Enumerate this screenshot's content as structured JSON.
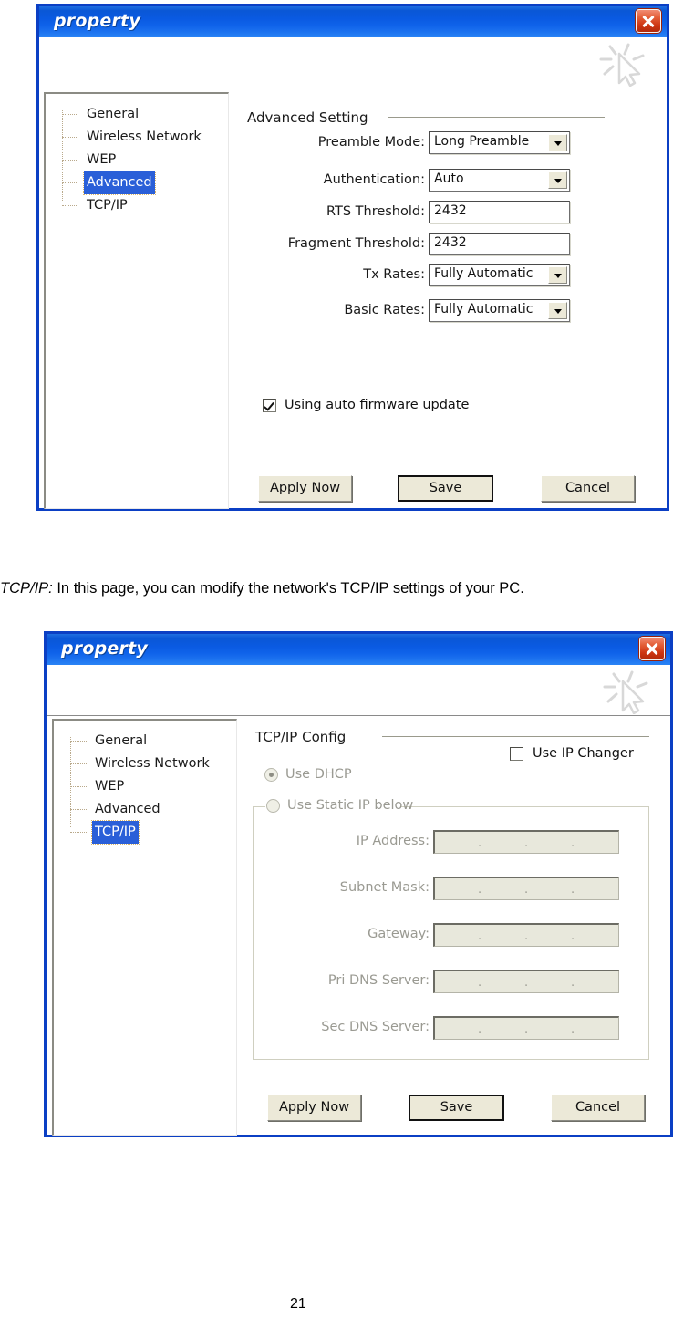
{
  "page": {
    "number": "21",
    "paragraph_emphasis": "TCP/IP:",
    "paragraph_text": " In this page, you can modify the network's TCP/IP settings of your PC."
  },
  "colors": {
    "titlebar_blue": "#0a57d6",
    "frame_blue": "#0b3fc4",
    "selection_blue": "#2a5fd8",
    "close_red": "#cd3512",
    "button_face": "#ece9d8",
    "disabled_field": "#e8e8dc",
    "disabled_text": "#9a9a92"
  },
  "dialog_advanced": {
    "title": "property",
    "close_label": "Close",
    "tree": {
      "items": [
        {
          "label": "General",
          "selected": false
        },
        {
          "label": "Wireless Network",
          "selected": false
        },
        {
          "label": "WEP",
          "selected": false
        },
        {
          "label": "Advanced",
          "selected": true
        },
        {
          "label": "TCP/IP",
          "selected": false
        }
      ]
    },
    "group_title": "Advanced Setting",
    "fields": [
      {
        "label": "Preamble Mode:",
        "value": "Long Preamble",
        "type": "combo"
      },
      {
        "label": "Authentication:",
        "value": "Auto",
        "type": "combo"
      },
      {
        "label": "RTS Threshold:",
        "value": "2432",
        "type": "text"
      },
      {
        "label": "Fragment Threshold:",
        "value": "2432",
        "type": "text"
      },
      {
        "label": "Tx Rates:",
        "value": "Fully Automatic",
        "type": "combo"
      },
      {
        "label": "Basic Rates:",
        "value": "Fully Automatic",
        "type": "combo"
      }
    ],
    "checkbox": {
      "label": "Using auto firmware update",
      "checked": true
    },
    "buttons": {
      "apply": "Apply Now",
      "save": "Save",
      "cancel": "Cancel"
    }
  },
  "dialog_tcpip": {
    "title": "property",
    "close_label": "Close",
    "tree": {
      "items": [
        {
          "label": "General",
          "selected": false
        },
        {
          "label": "Wireless Network",
          "selected": false
        },
        {
          "label": "WEP",
          "selected": false
        },
        {
          "label": "Advanced",
          "selected": false
        },
        {
          "label": "TCP/IP",
          "selected": true
        }
      ]
    },
    "group_title": "TCP/IP Config",
    "ip_changer": {
      "label": "Use IP Changer",
      "checked": false
    },
    "radios": [
      {
        "label": "Use DHCP",
        "selected": true
      },
      {
        "label": "Use Static IP below",
        "selected": false
      }
    ],
    "fields": [
      {
        "label": "IP Address:",
        "value": ""
      },
      {
        "label": "Subnet Mask:",
        "value": ""
      },
      {
        "label": "Gateway:",
        "value": ""
      },
      {
        "label": "Pri DNS Server:",
        "value": ""
      },
      {
        "label": "Sec DNS Server:",
        "value": ""
      }
    ],
    "ip_separator": ".",
    "buttons": {
      "apply": "Apply Now",
      "save": "Save",
      "cancel": "Cancel"
    }
  }
}
